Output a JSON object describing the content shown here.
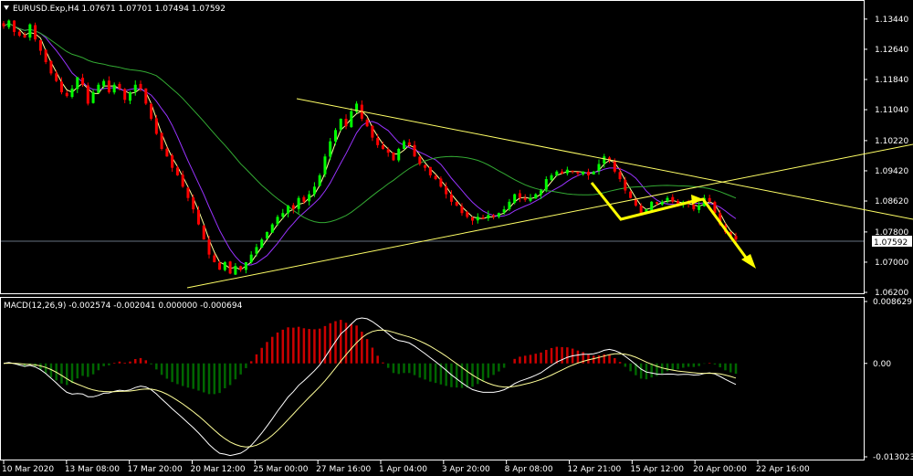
{
  "header": {
    "symbol_line": "EURUSD.Exp,H4  1.07671 1.07701 1.07494 1.07592",
    "macd_line": "MACD(12,26,9) -0.002574 -0.002041 0.000000 -0.000694"
  },
  "colors": {
    "background": "#000000",
    "frame": "#ffffff",
    "bull_candle": "#00ff00",
    "bear_candle": "#ff0000",
    "ma_fast": "#ffff99",
    "ma_mid": "#9933ff",
    "ma_slow": "#33aa33",
    "trendline": "#ffff66",
    "arrow": "#ffff00",
    "macd_line": "#ffffff",
    "signal_line": "#ffff99",
    "hist_pos": "#cc0000",
    "hist_neg": "#006600"
  },
  "price_axis": {
    "ticks": [
      "1.13440",
      "1.12640",
      "1.11840",
      "1.11040",
      "1.10220",
      "1.09420",
      "1.08620",
      "1.07800",
      "1.07000",
      "1.06200"
    ],
    "current_price": "1.07592"
  },
  "macd_axis": {
    "ticks": [
      "0.008629",
      "0.00",
      "-0.013023"
    ]
  },
  "time_axis": {
    "labels": [
      "10 Mar 2020",
      "13 Mar 08:00",
      "17 Mar 20:00",
      "20 Mar 12:00",
      "25 Mar 00:00",
      "27 Mar 16:00",
      "1 Apr 04:00",
      "3 Apr 20:00",
      "8 Apr 08:00",
      "12 Apr 21:00",
      "15 Apr 12:00",
      "20 Apr 00:00",
      "22 Apr 16:00"
    ]
  },
  "chart_data": {
    "type": "candlestick",
    "symbol": "EURUSD.Exp",
    "timeframe": "H4",
    "last_bar": {
      "open": 1.07671,
      "high": 1.07701,
      "low": 1.07494,
      "close": 1.07592
    },
    "ylim": [
      1.062,
      1.138
    ],
    "close_series": [
      1.1325,
      1.134,
      1.131,
      1.13,
      1.1295,
      1.133,
      1.129,
      1.126,
      1.123,
      1.12,
      1.118,
      1.115,
      1.114,
      1.116,
      1.119,
      1.117,
      1.112,
      1.115,
      1.117,
      1.118,
      1.115,
      1.117,
      1.116,
      1.113,
      1.115,
      1.117,
      1.116,
      1.112,
      1.108,
      1.104,
      1.1,
      1.098,
      1.095,
      1.093,
      1.09,
      1.087,
      1.084,
      1.08,
      1.076,
      1.072,
      1.07,
      1.068,
      1.07,
      1.067,
      1.069,
      1.068,
      1.07,
      1.072,
      1.074,
      1.076,
      1.078,
      1.08,
      1.082,
      1.083,
      1.085,
      1.084,
      1.087,
      1.086,
      1.088,
      1.09,
      1.093,
      1.098,
      1.102,
      1.105,
      1.108,
      1.106,
      1.11,
      1.112,
      1.108,
      1.106,
      1.103,
      1.101,
      1.1,
      1.099,
      1.097,
      1.1,
      1.102,
      1.101,
      1.098,
      1.096,
      1.095,
      1.093,
      1.092,
      1.09,
      1.088,
      1.086,
      1.085,
      1.083,
      1.082,
      1.081,
      1.082,
      1.0815,
      1.0825,
      1.082,
      1.083,
      1.084,
      1.086,
      1.088,
      1.087,
      1.0865,
      1.087,
      1.088,
      1.089,
      1.092,
      1.093,
      1.094,
      1.0935,
      1.0945,
      1.094,
      1.0935,
      1.094,
      1.093,
      1.094,
      1.096,
      1.098,
      1.097,
      1.094,
      1.092,
      1.089,
      1.087,
      1.085,
      1.083,
      1.084,
      1.086,
      1.0855,
      1.086,
      1.087,
      1.086,
      1.085,
      1.086,
      1.0855,
      1.084,
      1.085,
      1.087,
      1.086,
      1.083,
      1.08,
      1.078,
      1.077,
      1.076
    ],
    "moving_averages": [
      {
        "period": "fast"
      },
      {
        "period": "mid"
      },
      {
        "period": "slow"
      }
    ],
    "trendlines": [
      {
        "from": [
          "14 Mar",
          1.064
        ],
        "to": [
          "end",
          1.102
        ]
      },
      {
        "from": [
          "26 Mar",
          1.1145
        ],
        "to": [
          "end",
          1.083
        ]
      }
    ],
    "annotations": [
      {
        "type": "arrow_path",
        "points": [
          [
            1.098,
            "12 Apr"
          ],
          [
            1.081,
            "15 Apr"
          ],
          [
            1.0855,
            "20 Apr"
          ],
          [
            1.087,
            "22 Apr"
          ],
          [
            1.07,
            "24 Apr"
          ]
        ]
      }
    ],
    "macd": {
      "params": "12,26,9",
      "values": [
        -0.002574,
        -0.002041,
        0.0,
        -0.000694
      ],
      "ylim": [
        -0.013023,
        0.008629
      ]
    }
  }
}
